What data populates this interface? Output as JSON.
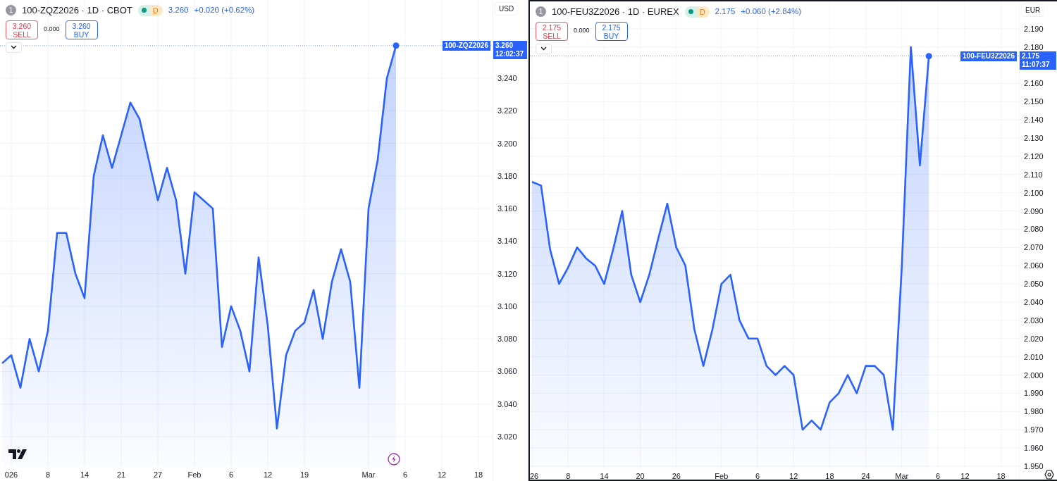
{
  "panels": [
    {
      "selected": false,
      "index_badge": "1",
      "symbol": "100-ZQZ2026 · 1D · CBOT",
      "session": "D",
      "last": "3.260",
      "change": "+0.020",
      "change_pct": "(+0.62%)",
      "sell_price": "3.260",
      "sell_label": "SELL",
      "spread": "0.000",
      "buy_price": "3.260",
      "buy_label": "BUY",
      "currency": "USD",
      "tag_symbol": "100-ZQZ2026",
      "tag_price": "3.260",
      "countdown": "12:02:37",
      "chart_data": {
        "type": "area",
        "categories": [
          null,
          "026",
          null,
          null,
          null,
          "8",
          null,
          null,
          null,
          "14",
          null,
          null,
          null,
          "21",
          null,
          null,
          null,
          "27",
          null,
          null,
          null,
          "Feb",
          null,
          null,
          null,
          "6",
          null,
          null,
          null,
          "12",
          null,
          null,
          null,
          "19",
          null,
          null,
          null,
          null,
          null,
          null,
          "Mar",
          null,
          null,
          null,
          "6",
          null,
          null,
          null,
          "12",
          null,
          null,
          null,
          "18"
        ],
        "series": [
          {
            "color": "#2962ff",
            "values": [
              3.065,
              3.07,
              3.05,
              3.08,
              3.06,
              3.085,
              3.145,
              3.145,
              3.12,
              3.105,
              3.18,
              3.205,
              3.185,
              3.205,
              3.225,
              3.215,
              3.19,
              3.165,
              3.185,
              3.165,
              3.12,
              3.17,
              3.165,
              3.16,
              3.075,
              3.1,
              3.085,
              3.06,
              3.13,
              3.088,
              3.025,
              3.07,
              3.085,
              3.09,
              3.11,
              3.08,
              3.115,
              3.135,
              3.115,
              3.05,
              3.16,
              3.19,
              3.24,
              3.26,
              null,
              null,
              null,
              null,
              null,
              null,
              null,
              null,
              null
            ]
          }
        ],
        "grid": true,
        "ref_lines": [
          {
            "axis": "y",
            "value": 3.26,
            "color": "#2962ff"
          }
        ],
        "ylim": [
          3.0014,
          3.288
        ],
        "yticks": [
          {
            "value": 3.02,
            "label": "3.020"
          },
          {
            "value": 3.04,
            "label": "3.040"
          },
          {
            "value": 3.06,
            "label": "3.060"
          },
          {
            "value": 3.08,
            "label": "3.080"
          },
          {
            "value": 3.1,
            "label": "3.100"
          },
          {
            "value": 3.12,
            "label": "3.120"
          },
          {
            "value": 3.14,
            "label": "3.140"
          },
          {
            "value": 3.16,
            "label": "3.160"
          },
          {
            "value": 3.18,
            "label": "3.180"
          },
          {
            "value": 3.2,
            "label": "3.200"
          },
          {
            "value": 3.22,
            "label": "3.220"
          },
          {
            "value": 3.24,
            "label": "3.240"
          }
        ]
      }
    },
    {
      "selected": true,
      "index_badge": "1",
      "symbol": "100-FEU3Z2026 · 1D · EUREX",
      "session": "D",
      "last": "2.175",
      "change": "+0.060",
      "change_pct": "(+2.84%)",
      "sell_price": "2.175",
      "sell_label": "SELL",
      "spread": "0.000",
      "buy_price": "2.175",
      "buy_label": "BUY",
      "currency": "EUR",
      "tag_symbol": "100-FEU3Z2026",
      "tag_price": "2.175",
      "countdown": "11:07:37",
      "chart_data": {
        "type": "area",
        "categories": [
          "26",
          null,
          null,
          null,
          "8",
          null,
          null,
          null,
          "14",
          null,
          null,
          null,
          "20",
          null,
          null,
          null,
          "26",
          null,
          null,
          null,
          null,
          "Feb",
          null,
          null,
          null,
          "6",
          null,
          null,
          null,
          "12",
          null,
          null,
          null,
          "18",
          null,
          null,
          null,
          "24",
          null,
          null,
          null,
          "Mar",
          null,
          null,
          null,
          "6",
          null,
          null,
          "12",
          null,
          null,
          null,
          "18"
        ],
        "series": [
          {
            "color": "#2962ff",
            "values": [
              2.106,
              2.104,
              2.069,
              2.05,
              2.059,
              2.07,
              2.064,
              2.06,
              2.05,
              2.069,
              2.09,
              2.055,
              2.04,
              2.055,
              2.075,
              2.094,
              2.07,
              2.06,
              2.025,
              2.005,
              2.025,
              2.05,
              2.055,
              2.03,
              2.02,
              2.02,
              2.005,
              2.0,
              2.005,
              2.0,
              1.97,
              1.975,
              1.97,
              1.985,
              1.99,
              2.0,
              1.99,
              2.005,
              2.005,
              2.0,
              1.97,
              2.06,
              2.18,
              2.115,
              2.175,
              null,
              null,
              null,
              null,
              null,
              null,
              null,
              null
            ]
          }
        ],
        "grid": true,
        "ref_lines": [
          {
            "axis": "y",
            "value": 2.175,
            "color": "#2962ff"
          }
        ],
        "ylim": [
          1.9488,
          2.205
        ],
        "yticks": [
          {
            "value": 1.95,
            "label": "1.950"
          },
          {
            "value": 1.96,
            "label": "1.960"
          },
          {
            "value": 1.97,
            "label": "1.970"
          },
          {
            "value": 1.98,
            "label": "1.980"
          },
          {
            "value": 1.99,
            "label": "1.990"
          },
          {
            "value": 2.0,
            "label": "2.000"
          },
          {
            "value": 2.01,
            "label": "2.010"
          },
          {
            "value": 2.02,
            "label": "2.020"
          },
          {
            "value": 2.03,
            "label": "2.030"
          },
          {
            "value": 2.04,
            "label": "2.040"
          },
          {
            "value": 2.05,
            "label": "2.050"
          },
          {
            "value": 2.06,
            "label": "2.060"
          },
          {
            "value": 2.07,
            "label": "2.070"
          },
          {
            "value": 2.08,
            "label": "2.080"
          },
          {
            "value": 2.09,
            "label": "2.090"
          },
          {
            "value": 2.1,
            "label": "2.100"
          },
          {
            "value": 2.11,
            "label": "2.110"
          },
          {
            "value": 2.12,
            "label": "2.120"
          },
          {
            "value": 2.13,
            "label": "2.130"
          },
          {
            "value": 2.14,
            "label": "2.140"
          },
          {
            "value": 2.15,
            "label": "2.150"
          },
          {
            "value": 2.16,
            "label": "2.160"
          },
          {
            "value": 2.18,
            "label": "2.180"
          },
          {
            "value": 2.19,
            "label": "2.190"
          }
        ]
      }
    }
  ]
}
